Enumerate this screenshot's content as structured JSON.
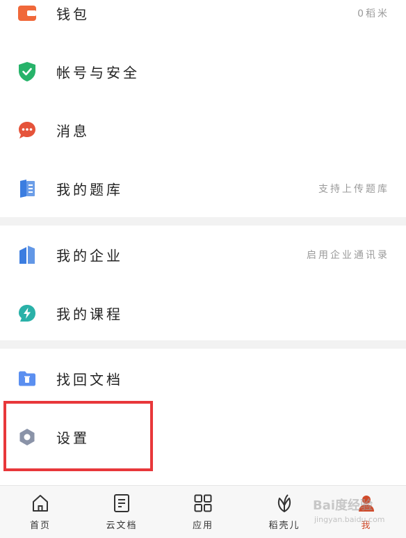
{
  "menu": {
    "wallet": {
      "label": "钱包",
      "value": "0稻米"
    },
    "account_security": {
      "label": "帐号与安全"
    },
    "messages": {
      "label": "消息"
    },
    "question_bank": {
      "label": "我的题库",
      "value": "支持上传题库"
    },
    "enterprise": {
      "label": "我的企业",
      "value": "启用企业通讯录"
    },
    "courses": {
      "label": "我的课程"
    },
    "recover_docs": {
      "label": "找回文档"
    },
    "settings": {
      "label": "设置"
    }
  },
  "tabbar": {
    "home": "首页",
    "cloud_docs": "云文档",
    "apps": "应用",
    "daoke": "稻壳儿",
    "me": "我"
  },
  "watermark": {
    "brand": "Bai度经验",
    "url": "jingyan.baidu.com"
  },
  "colors": {
    "wallet": "#f0683a",
    "shield": "#27b36a",
    "message": "#e5533a",
    "book": "#3b7de0",
    "enterprise": "#3b7de0",
    "course": "#2ab1a8",
    "folder": "#5b8ff0",
    "settings": "#8a93a8",
    "highlight": "#e8373a",
    "tab_active": "#d04a2a"
  }
}
